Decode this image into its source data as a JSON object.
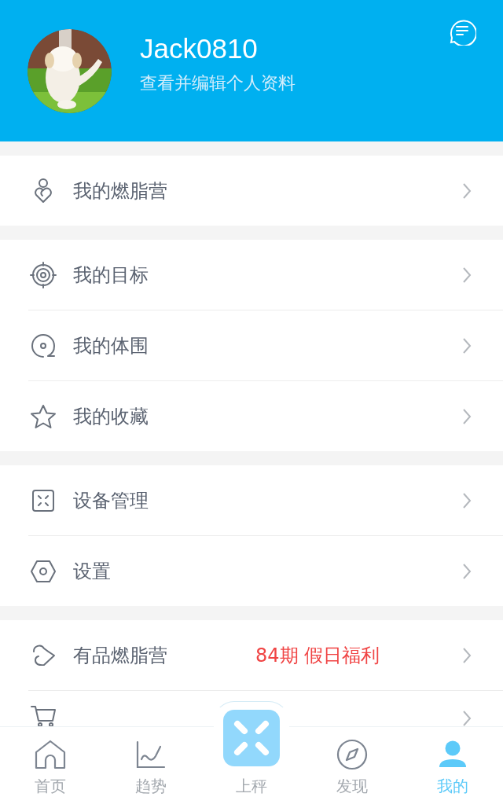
{
  "profile": {
    "username": "Jack0810",
    "subtitle": "查看并编辑个人资料"
  },
  "sections": [
    {
      "items": [
        {
          "label": "我的燃脂营"
        }
      ]
    },
    {
      "items": [
        {
          "label": "我的目标"
        },
        {
          "label": "我的体围"
        },
        {
          "label": "我的收藏"
        }
      ]
    },
    {
      "items": [
        {
          "label": "设备管理"
        },
        {
          "label": "设置"
        }
      ]
    },
    {
      "items": [
        {
          "label": "有品燃脂营",
          "promo": "84期 假日福利"
        },
        {
          "kind": "cut-off"
        }
      ]
    }
  ],
  "tab_bar": [
    {
      "label": "首页",
      "selected": false
    },
    {
      "label": "趋势",
      "selected": false
    },
    {
      "label": "上秤",
      "selected": false
    },
    {
      "label": "发现",
      "selected": false
    },
    {
      "label": "我的",
      "selected": true
    }
  ]
}
